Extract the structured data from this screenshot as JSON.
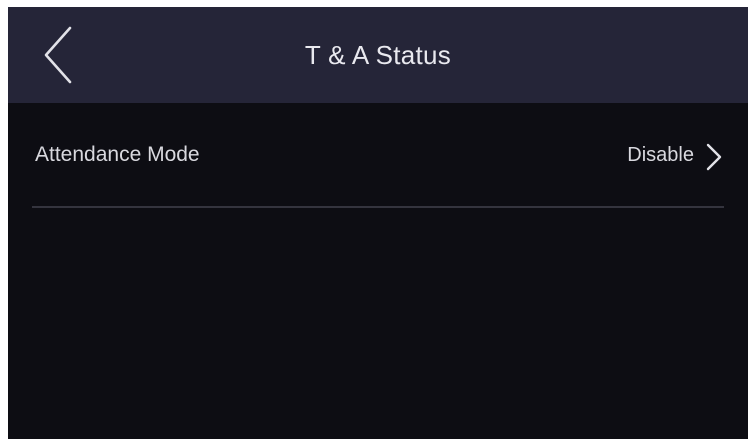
{
  "header": {
    "title": "T & A Status",
    "back_icon": "chevron-left-icon"
  },
  "settings": {
    "rows": [
      {
        "label": "Attendance Mode",
        "value": "Disable",
        "icon": "chevron-right-icon"
      }
    ]
  },
  "colors": {
    "header_background": "#252538",
    "page_background": "#0d0d13",
    "text": "#d9d9df",
    "divider": "#34343e"
  }
}
